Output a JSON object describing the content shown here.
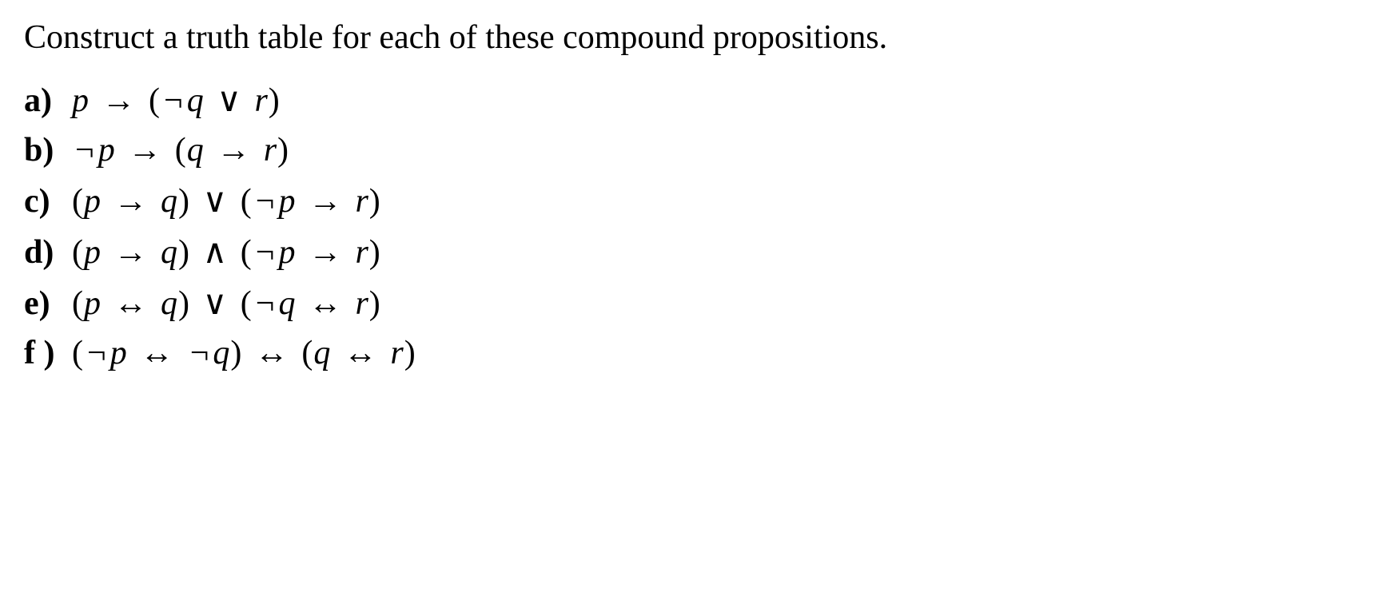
{
  "question": "Construct a truth table for each of these compound propositions.",
  "items": [
    {
      "label": "a)",
      "formula_html": "<span class='var'>p</span> <span class='op'>→</span> <span class='paren'>(</span><span class='op'>¬</span><span class='var'>q</span> <span class='op'>∨</span> <span class='var'>r</span><span class='paren'>)</span>"
    },
    {
      "label": "b)",
      "formula_html": "<span class='op'>¬</span><span class='var'>p</span> <span class='op'>→</span> <span class='paren'>(</span><span class='var'>q</span> <span class='op'>→</span> <span class='var'>r</span><span class='paren'>)</span>"
    },
    {
      "label": "c)",
      "formula_html": "<span class='paren'>(</span><span class='var'>p</span> <span class='op'>→</span> <span class='var'>q</span><span class='paren'>)</span> <span class='op'>∨</span> <span class='paren'>(</span><span class='op'>¬</span><span class='var'>p</span> <span class='op'>→</span> <span class='var'>r</span><span class='paren'>)</span>"
    },
    {
      "label": "d)",
      "formula_html": "<span class='paren'>(</span><span class='var'>p</span> <span class='op'>→</span> <span class='var'>q</span><span class='paren'>)</span> <span class='op'>∧</span> <span class='paren'>(</span><span class='op'>¬</span><span class='var'>p</span> <span class='op'>→</span> <span class='var'>r</span><span class='paren'>)</span>"
    },
    {
      "label": "e)",
      "formula_html": "<span class='paren'>(</span><span class='var'>p</span> <span class='op'>↔</span> <span class='var'>q</span><span class='paren'>)</span> <span class='op'>∨</span> <span class='paren'>(</span><span class='op'>¬</span><span class='var'>q</span> <span class='op'>↔</span> <span class='var'>r</span><span class='paren'>)</span>"
    },
    {
      "label": "f )",
      "formula_html": "<span class='paren'>(</span><span class='op'>¬</span><span class='var'>p</span> <span class='op'>↔</span> <span class='op'>¬</span><span class='var'>q</span><span class='paren'>)</span> <span class='op'>↔</span> <span class='paren'>(</span><span class='var'>q</span> <span class='op'>↔</span> <span class='var'>r</span><span class='paren'>)</span>"
    }
  ]
}
